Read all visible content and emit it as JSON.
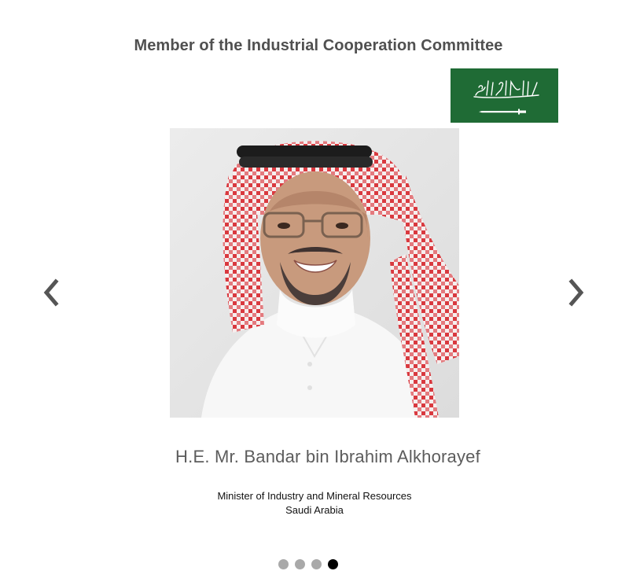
{
  "header": {
    "title": "Member of the Industrial Cooperation Committee"
  },
  "flag": {
    "icon": "saudi-arabia-flag",
    "inscription": "لا إله إلا الله محمد رسول الله",
    "color": "#1f6b35"
  },
  "carousel": {
    "prev_icon": "chevron-left-icon",
    "next_icon": "chevron-right-icon",
    "slide_count": 4,
    "active_slide": 4,
    "dot_color": "#a9a9a9",
    "active_dot_color": "#000000"
  },
  "member": {
    "name": "H.E. Mr. Bandar bin Ibrahim Alkhorayef",
    "position": "Minister of Industry and Mineral Resources",
    "country": "Saudi Arabia"
  }
}
